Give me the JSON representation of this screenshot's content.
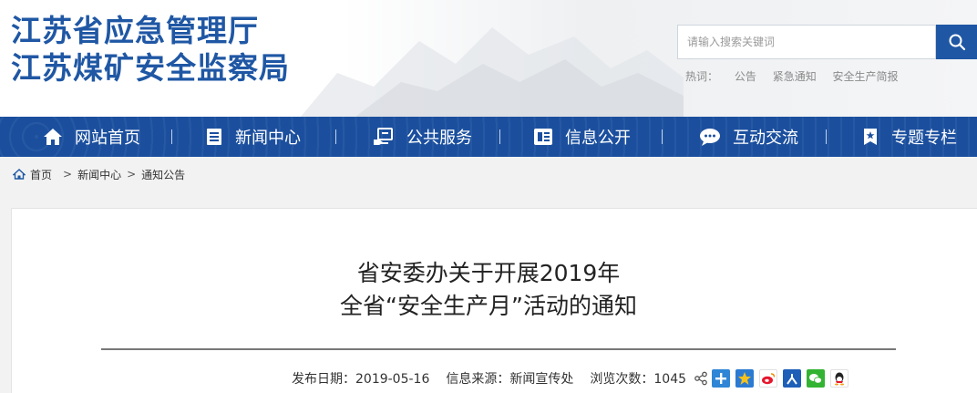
{
  "site": {
    "name_line1": "江苏省应急管理厅",
    "name_line2": "江苏煤矿安全监察局"
  },
  "search": {
    "placeholder": "请输入搜索关键词",
    "icon": "search-icon"
  },
  "hot": {
    "label": "热词：",
    "words": [
      "公告",
      "紧急通知",
      "安全生产简报"
    ]
  },
  "nav": {
    "items": [
      {
        "label": "网站首页",
        "icon": "home-icon"
      },
      {
        "label": "新闻中心",
        "icon": "news-icon"
      },
      {
        "label": "公共服务",
        "icon": "service-icon"
      },
      {
        "label": "信息公开",
        "icon": "info-icon"
      },
      {
        "label": "互动交流",
        "icon": "chat-icon"
      },
      {
        "label": "专题专栏",
        "icon": "bookmark-icon"
      }
    ]
  },
  "breadcrumb": {
    "items": [
      "首页",
      "新闻中心",
      "通知公告"
    ],
    "separator": ">"
  },
  "article": {
    "title_line1": "省安委办关于开展2019年",
    "title_line2": "全省“安全生产月”活动的通知",
    "publish_date": "发布日期：2019-05-16",
    "source": "信息来源：新闻宣传处",
    "views": "浏览次数：1045"
  },
  "share": {
    "icons": [
      "share-icon",
      "plus-share-icon",
      "qzone-icon",
      "weibo-icon",
      "renren-icon",
      "wechat-icon",
      "qq-icon"
    ]
  },
  "colors": {
    "brand_blue": "#1f57a4",
    "nav_blue": "#1b4f9e"
  }
}
